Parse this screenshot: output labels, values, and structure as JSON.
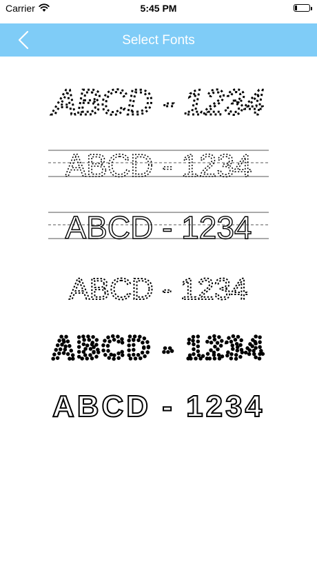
{
  "status_bar": {
    "carrier": "Carrier",
    "time": "5:45 PM"
  },
  "nav": {
    "title": "Select Fonts"
  },
  "font_options": [
    {
      "style": "dotted-print",
      "preview": "ABCD - 1234"
    },
    {
      "style": "guided-dotted",
      "preview": "ABCD - 1234"
    },
    {
      "style": "guided-solid",
      "preview": "ABCD - 1234"
    },
    {
      "style": "dashed-outline",
      "preview": "ABCD - 1234"
    },
    {
      "style": "dot-filled",
      "preview": "ABCD - 1234"
    },
    {
      "style": "cartoon-outline",
      "preview": "ABCD - 1234"
    }
  ],
  "colors": {
    "nav_background": "#7fccf7",
    "nav_text": "#ffffff",
    "preview_ink": "#000000"
  }
}
